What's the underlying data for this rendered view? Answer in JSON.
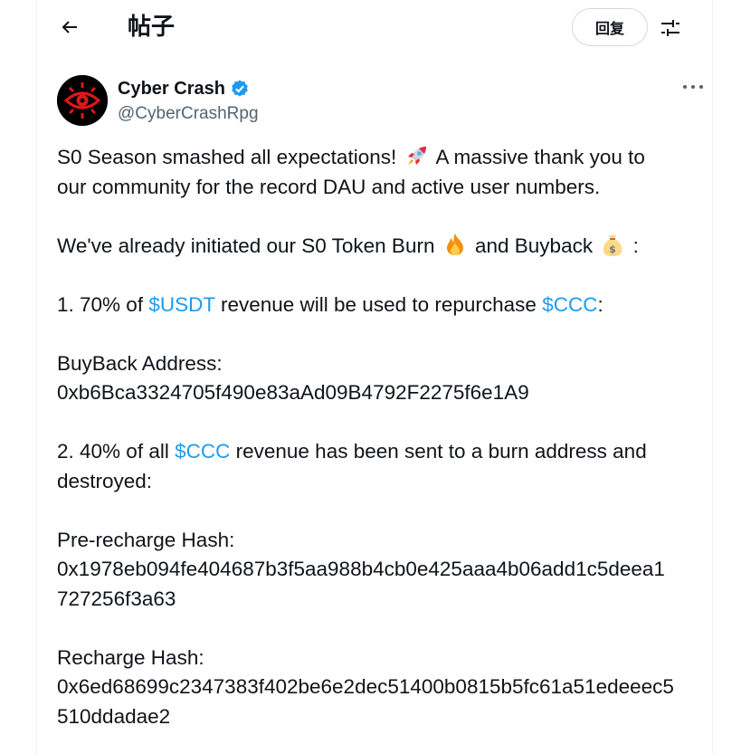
{
  "header": {
    "title": "帖子",
    "reply_label": "回复"
  },
  "author": {
    "name": "Cyber Crash",
    "handle": "@CyberCrashRpg",
    "verified": true
  },
  "post": {
    "p1_l1_a": "S0 Season smashed all expectations!",
    "p1_l1_b": "A massive thank you to",
    "p1_l2": "our community for the record DAU and active user numbers.",
    "p2_a": "We've already initiated our S0 Token Burn",
    "p2_b": "and Buyback",
    "p2_c": ":",
    "p3_a": "1. 70% of",
    "p3_tag1": "$USDT",
    "p3_b": "revenue will be used to repurchase",
    "p3_tag2": "$CCC",
    "p3_c": ":",
    "buyback_label": "BuyBack Address:",
    "buyback_address": "0xb6Bca3324705f490e83aAd09B4792F2275f6e1A9",
    "p4_a": "2. 40% of all",
    "p4_tag": "$CCC",
    "p4_b": "revenue has been sent to a burn address and",
    "p4_c": "destroyed:",
    "prehash_label": "Pre-recharge Hash:",
    "prehash_l1": "0x1978eb094fe404687b3f5aa988b4cb0e425aaa4b06add1c5deea1",
    "prehash_l2": "727256f3a63",
    "hash_label": "Recharge Hash:",
    "hash_l1": "0x6ed68699c2347383f402be6e2dec51400b0815b5fc61a51edeeec5",
    "hash_l2": "510ddadae2"
  },
  "icons": {
    "back": "arrow-left-icon",
    "settings": "sliders-icon",
    "more": "more-horizontal-icon",
    "verified": "verified-badge-icon",
    "rocket": "rocket-emoji",
    "fire": "fire-emoji",
    "money_bag": "money-bag-emoji"
  },
  "colors": {
    "link": "#1d9bf0",
    "text": "#0f1419",
    "secondary": "#536471",
    "avatar_accent": "#e0161b"
  }
}
